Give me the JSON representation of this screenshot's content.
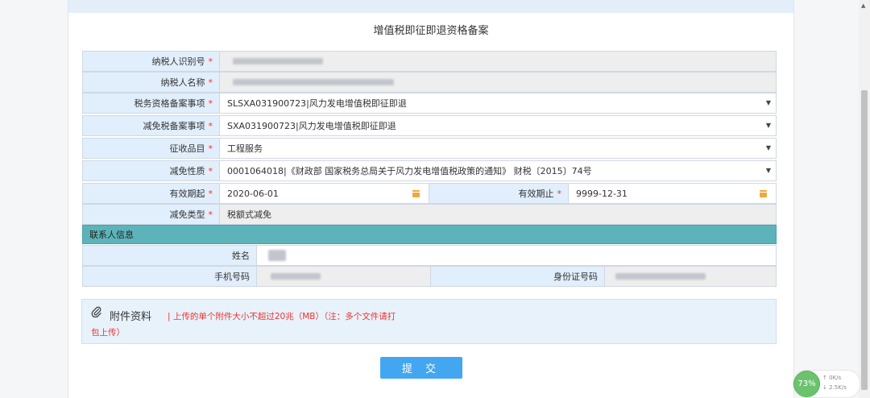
{
  "form": {
    "title": "增值税即征即退资格备案",
    "taxpayer_id_label": "纳税人识别号",
    "taxpayer_name_label": "纳税人名称",
    "tax_filing_item_label": "税务资格备案事项",
    "tax_filing_item_value": "SLSXA031900723|风力发电增值税即征即退",
    "reduction_item_label": "减免税备案事项",
    "reduction_item_value": "SXA031900723|风力发电增值税即征即退",
    "levy_item_label": "征收品目",
    "levy_item_value": "工程服务",
    "reduction_nature_label": "减免性质",
    "reduction_nature_value": "0001064018|《财政部 国家税务总局关于风力发电增值税政策的通知》 财税〔2015〕74号",
    "valid_from_label": "有效期起",
    "valid_from_value": "2020-06-01",
    "valid_to_label": "有效期止",
    "valid_to_value": "9999-12-31",
    "reduction_type_label": "减免类型",
    "reduction_type_value": "税额式减免",
    "required_mark": "*"
  },
  "contact": {
    "section_title": "联系人信息",
    "name_label": "姓名",
    "phone_label": "手机号码",
    "id_card_label": "身份证号码"
  },
  "attachments": {
    "title": "附件资料",
    "note_line1": "| 上传的单个附件大小不超过20兆（MB）（注：多个文件请打",
    "note_line2": "包上传）"
  },
  "actions": {
    "submit_label": "提 交"
  },
  "widget": {
    "percent": "73%",
    "upload_rate": "0K/s",
    "download_rate": "2.5K/s",
    "up_arrow": "↑",
    "down_arrow": "↓"
  },
  "icons": {
    "attach": "paperclip-icon",
    "calendar": "calendar-icon",
    "dropdown": "caret-down-icon"
  }
}
